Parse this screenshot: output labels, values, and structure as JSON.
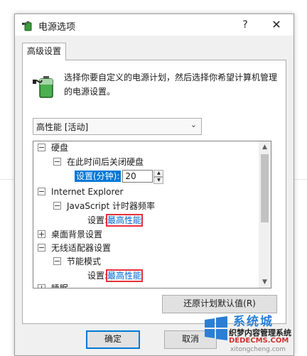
{
  "window": {
    "title": "电源选项",
    "help_glyph": "?",
    "close_glyph": "✕"
  },
  "tabs": [
    {
      "label": "高级设置"
    }
  ],
  "description": "选择你要自定义的电源计划，然后选择你希望计算机管理的电源设置。",
  "plan_select": {
    "value": "高性能 [活动]"
  },
  "tree": {
    "harddisk": "硬盘",
    "harddisk_off": "在此时间后关闭硬盘",
    "harddisk_off_label": "设置(分钟):",
    "harddisk_off_value": "20",
    "ie": "Internet Explorer",
    "js_timer": "JavaScript 计时器频率",
    "js_setting_label": "设置:",
    "js_setting_value": "最高性能",
    "desktop_bg": "桌面背景设置",
    "wireless": "无线适配器设置",
    "power_save": "节能模式",
    "power_save_label": "设置:",
    "power_save_value": "最高性能",
    "sleep": "睡眠"
  },
  "buttons": {
    "restore": "还原计划默认值(R)",
    "ok": "确定",
    "cancel": "取消"
  },
  "watermark": {
    "brand": "系统城",
    "line1": "织梦内容管理系统",
    "line2": "DEDECMS.COM",
    "line3": "xitongcheng.com"
  },
  "colors": {
    "selection_blue": "#0078d7",
    "highlight_red": "#e8303a",
    "value_blue": "#0066cc"
  },
  "icons": {
    "title": "battery-plug-icon",
    "description": "battery-plug-icon"
  }
}
